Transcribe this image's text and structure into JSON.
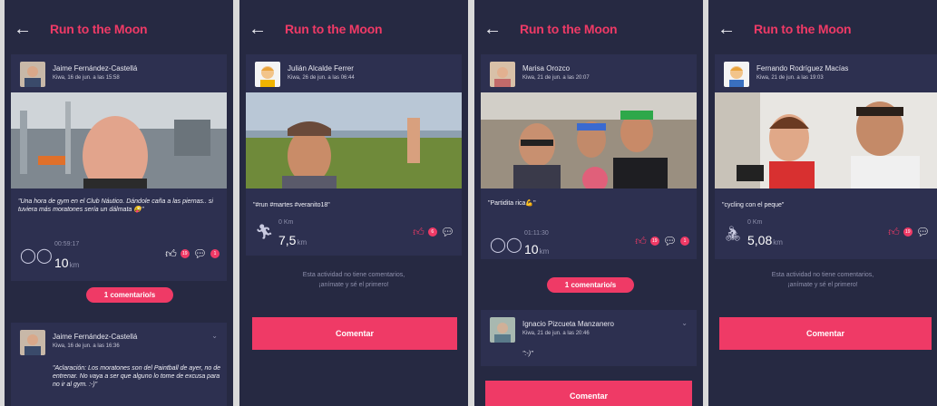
{
  "app": {
    "title": "Run to the Moon",
    "back_icon": "arrow-left-icon"
  },
  "screens": [
    {
      "post": {
        "user": "Jaime Fernández-Castellá",
        "date": "Kiwa, 16 de jun. a las 15:58",
        "caption": "\"Una hora de gym en el Club Náutico. Dándole caña a las piernas.. si tuviera más moratones sería un dálmata 😜\"",
        "stat_small": "00:59:17",
        "stat_value": "10",
        "stat_unit": "km",
        "likes": "19",
        "comments": "1"
      },
      "comments_pill": "1 comentario/s",
      "comment": {
        "user": "Jaime Fernández-Castellá",
        "date": "Kiwa, 16 de jun. a las 16:36",
        "text": "\"Aclaración: Los moratones son del Paintball de ayer, no de entrenar. No vaya a ser que alguno lo tome de excusa para no ir al gym. :-)\""
      }
    },
    {
      "post": {
        "user": "Julián Alcalde Ferrer",
        "date": "Kiwa, 26 de jun. a las 06:44",
        "caption": "\"#run #martes #veranito18\"",
        "stat_small": "0 Km",
        "stat_value": "7,5",
        "stat_unit": "km",
        "likes": "6"
      },
      "empty_text": "Esta actividad no tiene comentarios, ¡anímate y sé el primero!",
      "comment_button": "Comentar"
    },
    {
      "post": {
        "user": "Marisa Orozco",
        "date": "Kiwa, 21 de jun. a las 20:07",
        "caption": "\"Partidita rica💪\"",
        "stat_small": "01:11:30",
        "stat_value": "10",
        "stat_unit": "km",
        "likes": "19",
        "comments": "1"
      },
      "comments_pill": "1 comentario/s",
      "comment": {
        "user": "Ignacio Pizcueta Manzanero",
        "date": "Kiwa, 21 de jun. a las 20:46",
        "text": "\":-)\""
      },
      "comment_button": "Comentar"
    },
    {
      "post": {
        "user": "Fernando Rodríguez Macías",
        "date": "Kiwa, 21 de jun. a las 19:03",
        "caption": "\"cycling con el peque\"",
        "stat_small": "0 Km",
        "stat_value": "5,08",
        "stat_unit": "km",
        "likes": "19"
      },
      "empty_text": "Esta actividad no tiene comentarios, ¡anímate y sé el primero!",
      "comment_button": "Comentar"
    }
  ]
}
